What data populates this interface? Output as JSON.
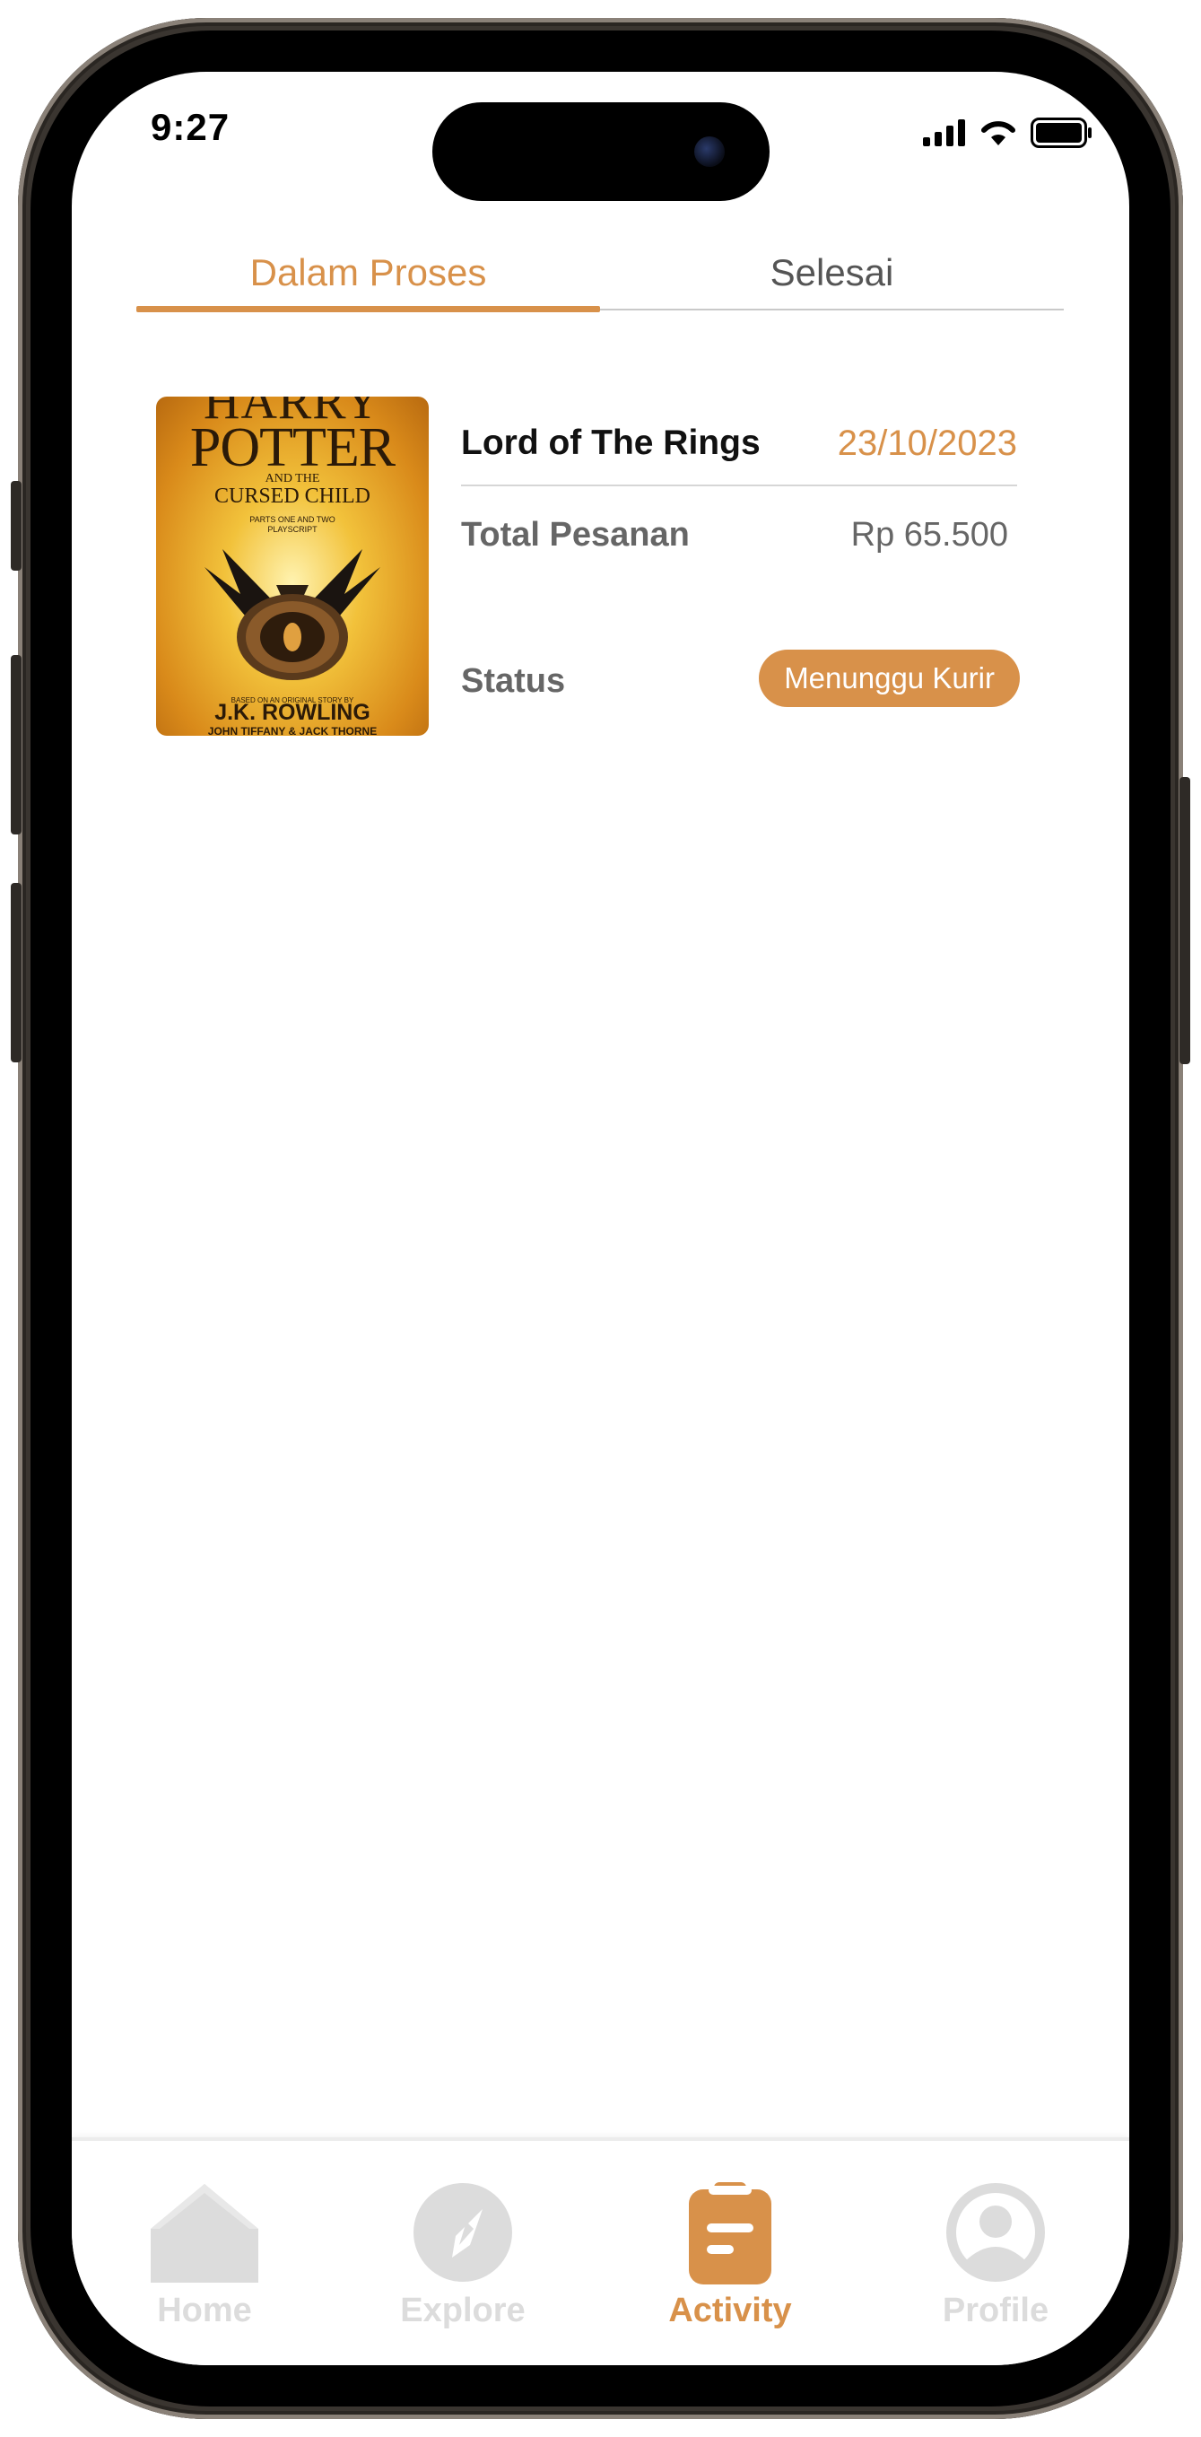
{
  "status_bar": {
    "time": "9:27"
  },
  "tabs": [
    {
      "label": "Dalam Proses",
      "active": true
    },
    {
      "label": "Selesai",
      "active": false
    }
  ],
  "order": {
    "cover": {
      "line1": "HARRY",
      "line2": "POTTER",
      "line3": "AND THE",
      "line4": "CURSED CHILD",
      "line5": "PARTS ONE AND TWO",
      "line6": "PLAYSCRIPT",
      "line7": "BASED ON AN ORIGINAL STORY BY",
      "author": "J.K. ROWLING",
      "coauthors": "JOHN TIFFANY & JACK THORNE"
    },
    "title": "Lord of The Rings",
    "date": "23/10/2023",
    "total_label": "Total Pesanan",
    "total_value": "Rp 65.500",
    "status_label": "Status",
    "status_value": "Menunggu Kurir"
  },
  "colors": {
    "accent": "#d8914a",
    "nav_inactive": "#dcdcdc"
  },
  "bottom_nav": [
    {
      "label": "Home",
      "icon": "home-icon",
      "active": false
    },
    {
      "label": "Explore",
      "icon": "compass-icon",
      "active": false
    },
    {
      "label": "Activity",
      "icon": "clipboard-icon",
      "active": true
    },
    {
      "label": "Profile",
      "icon": "profile-icon",
      "active": false
    }
  ]
}
